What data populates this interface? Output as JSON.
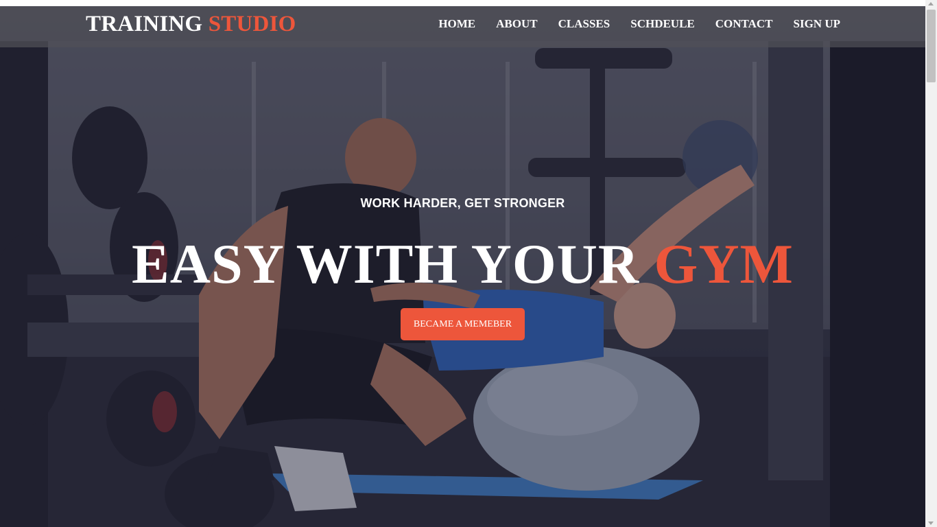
{
  "brand": {
    "name_part1": "TRAINING",
    "name_part2": "STUDIO",
    "accent_color": "#ed563b"
  },
  "nav": {
    "items": [
      {
        "label": "HOME"
      },
      {
        "label": "ABOUT"
      },
      {
        "label": "CLASSES"
      },
      {
        "label": "SCHDEULE"
      },
      {
        "label": "CONTACT"
      },
      {
        "label": "SIGN UP"
      }
    ]
  },
  "hero": {
    "tagline": "WORK HARDER, GET STRONGER",
    "headline_part1": "EASY WITH YOUR",
    "headline_part2": "GYM",
    "cta_label": "BECAME A MEMEBER",
    "background_image": "gym-training-photo"
  }
}
